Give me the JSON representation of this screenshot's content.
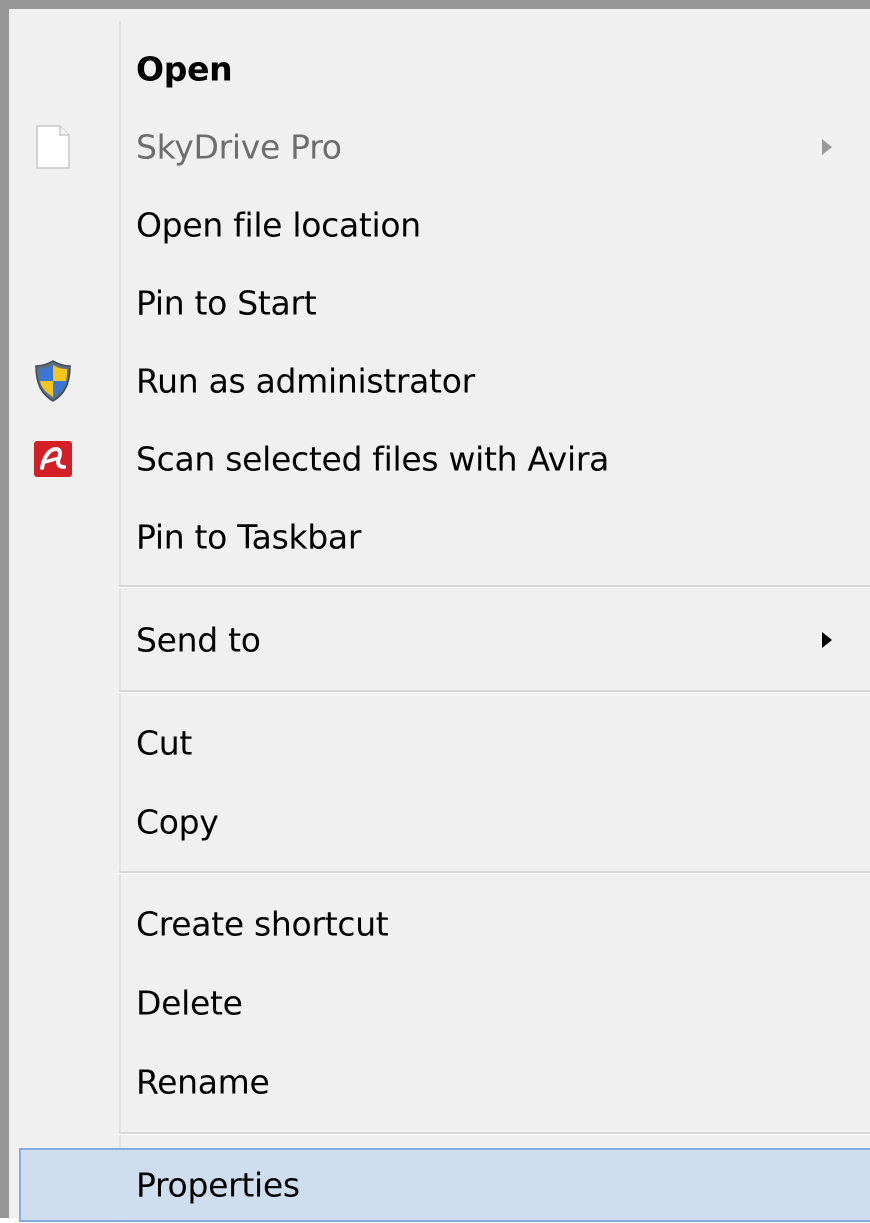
{
  "context_menu": {
    "items": [
      {
        "label": "Open",
        "bold": true
      },
      {
        "label": "SkyDrive Pro",
        "disabled": true,
        "icon": "document-icon",
        "submenu": true
      },
      {
        "label": "Open file location"
      },
      {
        "label": "Pin to Start"
      },
      {
        "label": "Run as administrator",
        "icon": "uac-shield-icon"
      },
      {
        "label": "Scan selected files with Avira",
        "icon": "avira-icon"
      },
      {
        "label": "Pin to Taskbar"
      },
      {
        "label": "Send to",
        "submenu": true
      },
      {
        "label": "Cut"
      },
      {
        "label": "Copy"
      },
      {
        "label": "Create shortcut"
      },
      {
        "label": "Delete"
      },
      {
        "label": "Rename"
      },
      {
        "label": "Properties",
        "highlighted": true
      }
    ]
  },
  "colors": {
    "menu_background": "#f0f0f0",
    "highlight_background": "#cfdeef",
    "highlight_border": "#84acdd",
    "disabled_text": "#6d6d6d",
    "avira_red": "#d51f26"
  }
}
